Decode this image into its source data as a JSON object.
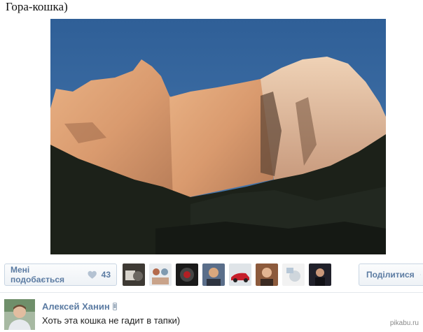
{
  "post": {
    "title": "Гора-кошка)",
    "image_alt": "cat-shaped mountain"
  },
  "actions": {
    "like_label": "Мені подобається",
    "like_count": "43",
    "likers": [
      {
        "name": "avatar-1"
      },
      {
        "name": "avatar-2"
      },
      {
        "name": "avatar-3"
      },
      {
        "name": "avatar-4"
      },
      {
        "name": "avatar-5"
      },
      {
        "name": "avatar-6"
      },
      {
        "name": "avatar-7"
      },
      {
        "name": "avatar-8"
      }
    ],
    "share_label": "Поділитися"
  },
  "comment": {
    "author": "Алексей Ханин",
    "text": "Хоть эта кошка не гадит в тапки)"
  },
  "watermark": "pikabu.ru",
  "colors": {
    "link": "#5b7ba2",
    "sky": "#3b6aa0",
    "rock": "#e3a57a"
  }
}
